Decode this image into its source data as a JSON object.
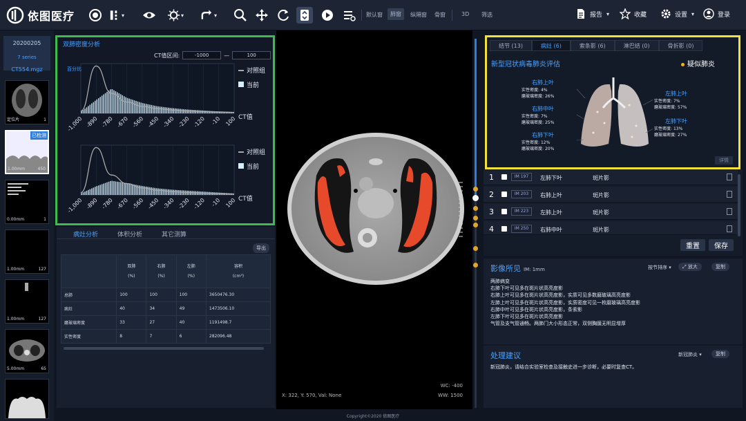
{
  "app": {
    "title": "依图医疗"
  },
  "toolbar": {
    "text_items": [
      "默认窗",
      "肺窗",
      "纵隔窗",
      "骨窗",
      "3D",
      "筛选"
    ],
    "report_label": "报告",
    "favorite_label": "收藏",
    "settings_label": "设置",
    "login_label": "登录"
  },
  "series_panel": {
    "date": "20200205",
    "count": "7 series",
    "name": "CT554.mgz",
    "thumbs": [
      {
        "left": "定位片",
        "right": "1",
        "tag": ""
      },
      {
        "left": "1.00mm",
        "right": "450",
        "tag": "已检测"
      },
      {
        "left": "0.00mm",
        "right": "1",
        "tag": ""
      },
      {
        "left": "1.00mm",
        "right": "127",
        "tag": ""
      },
      {
        "left": "1.00mm",
        "right": "127",
        "tag": ""
      },
      {
        "left": "5.00mm",
        "right": "65",
        "tag": ""
      },
      {
        "left": "",
        "right": "",
        "tag": ""
      }
    ]
  },
  "density_panel": {
    "title": "双肺密度分析",
    "ct_range_label": "CT值区间:",
    "ct_min": "-1000",
    "ct_max": "100",
    "separator": "—"
  },
  "chart_data": [
    {
      "type": "area",
      "xlabel": "CT值",
      "ylabel": "百分比",
      "x": [
        -1000,
        -890,
        -780,
        -670,
        -560,
        -450,
        -340,
        -230,
        -120,
        -10,
        100
      ],
      "xticks": [
        "-1,000",
        "-890",
        "-780",
        "-670",
        "-560",
        "-450",
        "-340",
        "-230",
        "-120",
        "-10",
        "100"
      ],
      "series": [
        {
          "name": "对照组",
          "values": [
            0.5,
            10,
            4.2,
            2.4,
            1.5,
            1.0,
            0.7,
            0.5,
            0.4,
            0.3,
            0.2
          ]
        },
        {
          "name": "当前",
          "values": [
            0.3,
            2.8,
            5.2,
            3.3,
            2.2,
            1.5,
            1.1,
            0.8,
            0.6,
            0.4,
            0.3
          ]
        }
      ],
      "colors": {
        "对照组": "#a9a9a9",
        "当前": "#d4efff"
      },
      "legend": "right"
    },
    {
      "type": "area",
      "xlabel": "CT值",
      "ylabel": "",
      "x": [
        -1000,
        -890,
        -780,
        -670,
        -560,
        -450,
        -340,
        -230,
        -120,
        -10,
        100
      ],
      "xticks": [
        "-1,000",
        "-890",
        "-780",
        "-670",
        "-560",
        "-450",
        "-340",
        "-230",
        "-120",
        "-10",
        "100"
      ],
      "series": [
        {
          "name": "对照组",
          "values": [
            0.5,
            10,
            4.2,
            2.4,
            1.5,
            1.0,
            0.7,
            0.5,
            0.4,
            0.3,
            0.2
          ]
        },
        {
          "name": "当前",
          "values": [
            0.3,
            1.8,
            3.0,
            2.5,
            1.9,
            1.4,
            1.1,
            0.9,
            0.7,
            0.5,
            0.3
          ]
        }
      ],
      "colors": {
        "对照组": "#a9a9a9",
        "当前": "#d4efff"
      },
      "legend": "right"
    }
  ],
  "analysis_tabs": [
    {
      "label": "病灶分析",
      "active": true
    },
    {
      "label": "体积分析",
      "active": false
    },
    {
      "label": "其它测算",
      "active": false
    }
  ],
  "export_label": "导出",
  "table": {
    "headers": [
      "",
      "双肺\n(%)",
      "右肺\n(%)",
      "左肺\n(%)",
      "容积\n(cm³)"
    ],
    "rows": [
      [
        "总肺",
        "100",
        "100",
        "100",
        "3650476.30"
      ],
      [
        "病灶",
        "40",
        "34",
        "49",
        "1473506.10"
      ],
      [
        "磨玻璃密度",
        "33",
        "27",
        "40",
        "1191498.7"
      ],
      [
        "实性密度",
        "8",
        "7",
        "6",
        "282096.48"
      ]
    ]
  },
  "viewer": {
    "coords": "X: 322, Y: 570, Val: None",
    "wc": "WC: -400",
    "ww": "WW: 1500"
  },
  "copyright": "Copyright©2020 依图医疗",
  "lesion_tabs": [
    {
      "label": "结节 (13)",
      "active": false
    },
    {
      "label": "病灶 (6)",
      "active": true
    },
    {
      "label": "索条影 (6)",
      "active": false
    },
    {
      "label": "淋巴结 (0)",
      "active": false
    },
    {
      "label": "骨折影 (0)",
      "active": false
    }
  ],
  "lung_eval": {
    "title": "新型冠状病毒肺炎评估",
    "suspect": "疑似肺炎",
    "lobes": [
      {
        "name": "右肺上叶",
        "solid_label": "实性密度:",
        "solid": "4%",
        "ggo_label": "磨玻璃密度:",
        "ggo": "26%"
      },
      {
        "name": "右肺中叶",
        "solid_label": "实性密度:",
        "solid": "7%",
        "ggo_label": "磨玻璃密度:",
        "ggo": "25%"
      },
      {
        "name": "右肺下叶",
        "solid_label": "实性密度:",
        "solid": "12%",
        "ggo_label": "磨玻璃密度:",
        "ggo": "20%"
      },
      {
        "name": "左肺上叶",
        "solid_label": "实性密度:",
        "solid": "7%",
        "ggo_label": "磨玻璃密度:",
        "ggo": "57%"
      },
      {
        "name": "左肺下叶",
        "solid_label": "实性密度:",
        "solid": "13%",
        "ggo_label": "磨玻璃密度:",
        "ggo": "27%"
      }
    ],
    "more": "详情"
  },
  "finding_rows": [
    {
      "n": "1",
      "id": "IM 197",
      "lobe": "左肺下叶",
      "type": "斑片影"
    },
    {
      "n": "2",
      "id": "IM 203",
      "lobe": "右肺上叶",
      "type": "斑片影"
    },
    {
      "n": "3",
      "id": "IM 223",
      "lobe": "左肺上叶",
      "type": "斑片影"
    },
    {
      "n": "4",
      "id": "IM 250",
      "lobe": "右肺中叶",
      "type": "斑片影"
    }
  ],
  "actions": {
    "reset": "重置",
    "save": "保存"
  },
  "findings": {
    "title": "影像所见",
    "sub": "IM: 1mm",
    "sort": "按节排序",
    "enlarge": "放大",
    "copy": "复制",
    "lines": [
      "两肺病变",
      "右肺下叶可见多在斑片状高亮度影",
      "右肺上叶可见多在斑片状高亮度影，实质可见多数磨玻璃高亮度影",
      "左肺上叶可见多在斑片状高亮度影，实质密度可见一枚磨玻璃高亮度影",
      "右肺中叶可见多在斑片状高亮度影，条索影",
      "左肺下叶可见多在斑片状高亮度影",
      "气管及支气管通畅。两肺门大小形态正常，双侧胸膜无明显增厚"
    ]
  },
  "advice": {
    "title": "处理建议",
    "template": "新冠肺炎",
    "copy": "复制",
    "text": "新冠肺炎，请结合实验室检查及接触史进一步诊断，必要时复查CT。"
  }
}
